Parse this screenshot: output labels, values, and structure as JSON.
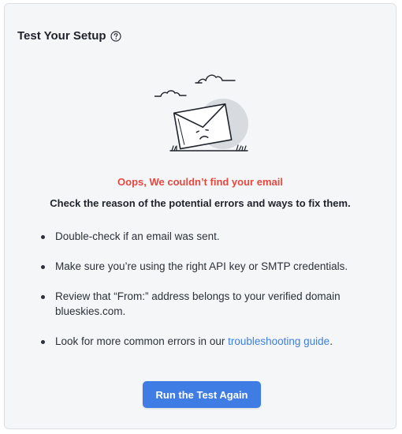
{
  "header": {
    "title": "Test Your Setup",
    "help_icon": "question-circle-icon"
  },
  "illustration": {
    "icon": "sad-envelope-illustration"
  },
  "status": {
    "error_message": "Oops, We couldn’t find your email",
    "error_color": "#e5483f"
  },
  "guidance": {
    "heading": "Check the reason of the potential errors and ways to fix them.",
    "tips": [
      "Double-check if an email was sent.",
      "Make sure you’re using the right API key or SMTP credentials.",
      "Review that “From:” address belongs to your verified domain blueskies.com."
    ],
    "tip4_prefix": "Look for more common errors in our ",
    "tip4_link": "troubleshooting guide",
    "tip4_suffix": "."
  },
  "actions": {
    "run_again_label": "Run the Test Again",
    "accent_color": "#3f7de5"
  }
}
